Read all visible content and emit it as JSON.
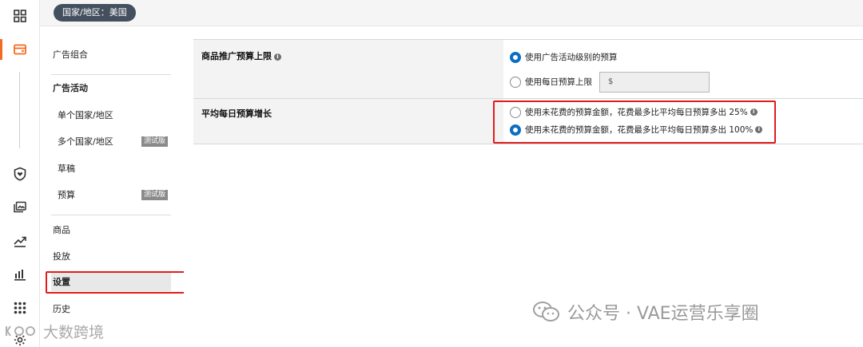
{
  "topbar": {
    "region_label": "国家/地区：美国"
  },
  "rail": {
    "icons": [
      "grid-icon",
      "wallet-icon",
      "shield-icon",
      "media-icon",
      "trend-icon",
      "bar-chart-icon",
      "apps-icon",
      "gear-icon"
    ],
    "active_index": 1,
    "accent": "#f26b21"
  },
  "nav": {
    "portfolios": "广告组合",
    "campaigns_header": "广告活动",
    "single_country": "单个国家/地区",
    "multi_country": "多个国家/地区",
    "multi_country_badge": "测试版",
    "drafts": "草稿",
    "budgets": "预算",
    "budgets_badge": "测试版",
    "products": "商品",
    "placement": "投放",
    "settings": "设置",
    "history": "历史"
  },
  "settings": {
    "budget_cap": {
      "label": "商品推广预算上限",
      "option_campaign": "使用广告活动级别的预算",
      "option_daily": "使用每日预算上限",
      "daily_input_placeholder": "$",
      "selected": "option_campaign"
    },
    "avg_daily_growth": {
      "label": "平均每日预算增长",
      "option_25": "使用未花费的预算金额，花费最多比平均每日预算多出 25%",
      "option_100": "使用未花费的预算金额，花费最多比平均每日预算多出 100%",
      "selected": "option_100"
    }
  },
  "colors": {
    "radio_on": "#0a6ec2",
    "highlight": "#e21c1c",
    "chip_bg": "#44505e"
  },
  "watermarks": {
    "right": "公众号 · VAE运营乐享圈",
    "left": "大数跨境"
  }
}
